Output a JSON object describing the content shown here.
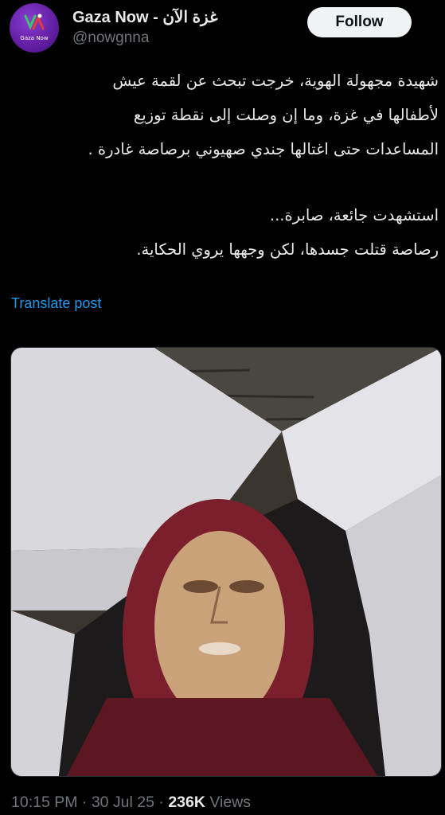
{
  "account": {
    "display_name": "Gaza Now - غزة الآن",
    "handle": "@nowgnna",
    "avatar_logo_text": "Gaza Now",
    "avatar_icon": "gaza-now-logo"
  },
  "follow_button": {
    "label": "Follow"
  },
  "post": {
    "lines": [
      "شهيدة مجهولة الهوية، خرجت تبحث عن لقمة عيش",
      "لأطفالها في غزة، وما إن وصلت إلى نقطة توزيع",
      "المساعدات حتى اغتالها جندي صهيوني برصاصة غادرة ."
    ],
    "lines_2": [
      "استشهدت جائعة، صابرة...",
      "رصاصة قتلت جسدها، لكن وجهها يروي الحكاية."
    ]
  },
  "translate_link": "Translate post",
  "meta": {
    "time": "10:15 PM",
    "separator": " · ",
    "date": "30 Jul 25",
    "views_count": "236K",
    "views_label": " Views"
  },
  "colors": {
    "background": "#000000",
    "text": "#e7e9ea",
    "muted": "#71767b",
    "link": "#1d9bf0",
    "avatar": "#6a24b3"
  }
}
